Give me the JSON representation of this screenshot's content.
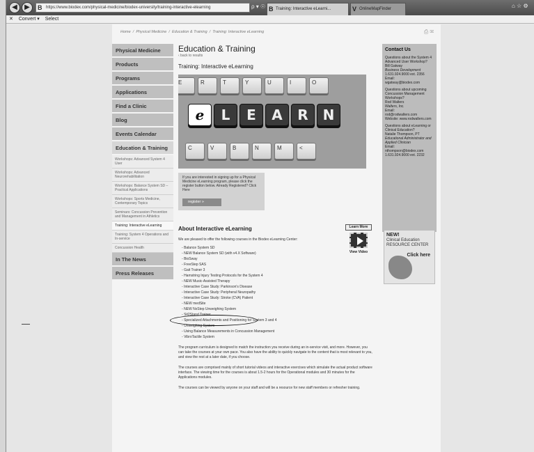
{
  "browser": {
    "address": "https://www.biodex.com/physical-medicine/biodex-university/training-interactive-elearning",
    "address_favicon": "B",
    "search_icons": "ρ ▾ ☉",
    "active_tab": "Training: Interactive eLearni...",
    "active_tab_favicon": "B",
    "second_tab": "OnlineMapFinder",
    "second_tab_favicon": "V",
    "window_controls": "⌂ ☆ ⚙",
    "toolbar": {
      "close": "✕",
      "convert": "Convert ▾",
      "select": "Select"
    }
  },
  "breadcrumb": {
    "items": [
      "Home",
      "Physical Medicine",
      "Education & Training",
      "Training: Interactive eLearning"
    ],
    "icons": "⎙ ✉"
  },
  "sidebar": {
    "items": [
      {
        "label": "Physical Medicine"
      },
      {
        "label": "Products"
      },
      {
        "label": "Programs"
      },
      {
        "label": "Applications"
      },
      {
        "label": "Find a Clinic"
      },
      {
        "label": "Blog"
      },
      {
        "label": "Events Calendar"
      },
      {
        "label": "Education & Training"
      }
    ],
    "subitems": [
      "Workshops: Advanced System 4 User",
      "Workshops: Advanced Neurorehabilitation",
      "Workshops: Balance System SD – Practical Applications",
      "Workshops: Sports Medicine, Contemporary Topics",
      "Seminars: Concussion Prevention and Management in Athletics",
      "Training: Interactive eLearning",
      "Training: System 4 Operations and In-service",
      "Concussion Health"
    ],
    "bottom_items": [
      {
        "label": "In The News"
      },
      {
        "label": "Press Releases"
      }
    ]
  },
  "content": {
    "title": "Education & Training",
    "back": "‹ back to results",
    "subtitle": "Training: Interactive eLearning",
    "banner": {
      "row1": [
        "E",
        "R",
        "T",
        "Y",
        "U",
        "I",
        "O"
      ],
      "learn": [
        "e",
        "L",
        "E",
        "A",
        "R",
        "N"
      ],
      "row3": [
        "C",
        "V",
        "B",
        "N",
        "M",
        "<"
      ]
    },
    "register_text": "If you are interested in signing up for a Physical Medicine eLearning program, please click the register button below. Already Registered? Click Here",
    "register_button": "register »",
    "about_title": "About Interactive eLearning",
    "about_intro": "We are pleased to offer the following courses in the Biodex eLearning Center:",
    "courses": [
      "Balance System SD",
      "NEW Balance System SD (with v4.X Software)",
      "BioSway",
      "FreeStep SAS",
      "Gait Trainer 3",
      "Hamstring Injury Testing Protocols for the System 4",
      "NEW Music-Assisted Therapy",
      "Interactive Case Study: Parkinson's Disease",
      "Interactive Case Study: Peripheral Neuropathy",
      "Interactive Case Study: Stroke (CVA) Patient",
      "NEW medSite",
      "NEW NxStep Unweighing System",
      "Sit2Stand Trainer",
      "Specialized Attachments and Positioning for System 3 and 4",
      "Unweighing System",
      "Using Balance Measurements in Concussion Management",
      "VibroTactile System"
    ],
    "para1": "The program curriculum is designed to match the instruction you receive during an in-service visit, and more. However, you can take the courses at your own pace. You also have the ability to quickly navigate to the content that is most relevant to you, and view the rest at a later date, if you choose.",
    "para2": "The courses are comprised mainly of short tutorial videos and interactive exercises which simulate the actual product software interface. The viewing time for the courses is about 1.5-2 hours for the Operational modules and 30 minutes for the Applications modules.",
    "para3": "The courses can be viewed by anyone on your staff and will be a resource for new staff members or refresher training.",
    "learn_more": "Learn More",
    "view_video": "View Video"
  },
  "contact": {
    "title": "Contact Us",
    "blocks": [
      {
        "q": "Questions about the System 4 Advanced User Workshop?",
        "name": "Bill Gatway",
        "role": "Business Development",
        "phone": "1.631.924.9000 ext. 2356",
        "email_label": "Email:",
        "email": "wgatway@biodex.com"
      },
      {
        "q": "Questions about upcoming Concussion Management Workshops?",
        "name": "Rod Walters",
        "role": "Walters, Inc.",
        "phone": "Email:",
        "email_label": "rod@rodwalters.com",
        "email": "Website: www.rodwalters.com"
      },
      {
        "q": "Questions about eLearning or Clinical Education?",
        "name": "Natalie Thompson, PT",
        "role": "Educational Administrator and Applied Clinician",
        "phone": "Email:",
        "email_label": "nthompson@biodex.com",
        "email": "1.631.924.9000 ext. 2232"
      }
    ]
  },
  "ad": {
    "new": "NEW!",
    "title": "Clinical Education",
    "subtitle": "RESOURCE CENTER",
    "cta": "Click here"
  }
}
